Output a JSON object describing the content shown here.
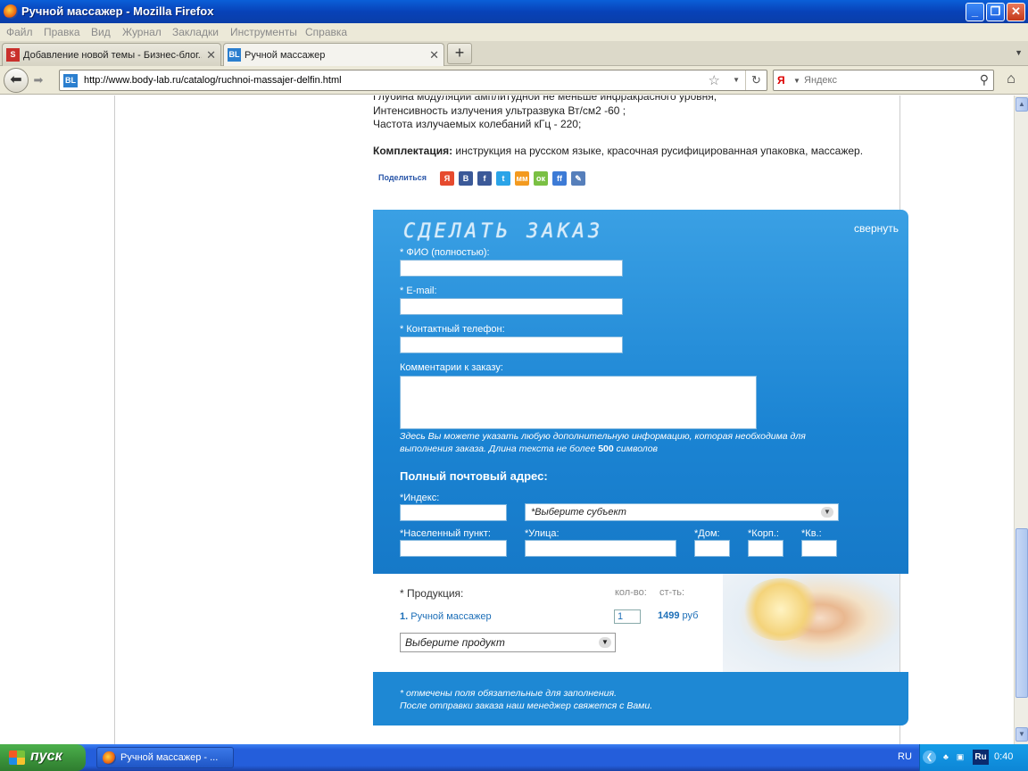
{
  "window": {
    "title": "Ручной массажер - Mozilla Firefox"
  },
  "menu": [
    "Файл",
    "Правка",
    "Вид",
    "Журнал",
    "Закладки",
    "Инструменты",
    "Справка"
  ],
  "tabs": [
    {
      "label": "Добавление новой темы - Бизнес-блог...",
      "favicon": "S",
      "active": false
    },
    {
      "label": "Ручной массажер",
      "favicon": "BL",
      "active": true
    }
  ],
  "nav": {
    "url": "http://www.body-lab.ru/catalog/ruchnoi-massajer-delfin.html",
    "favicon": "BL",
    "search_engine": "Я",
    "search_placeholder": "Яндекс"
  },
  "page": {
    "spec_lines": [
      "Глубина модуляции амплитудной не меньше инфракрасного уровня;",
      "Интенсивность излучения ультразвука Вт/см2 -60 ;",
      "Частота излучаемых колебаний кГц - 220;"
    ],
    "kit_label": "Комплектация:",
    "kit_text": " инструкция на русском языке, красочная русифицированная упаковка, массажер.",
    "share_label": "Поделиться",
    "social": [
      {
        "name": "ya-icon",
        "glyph": "Я",
        "color": "#e64a2e"
      },
      {
        "name": "vk-icon",
        "glyph": "В",
        "color": "#3b5998"
      },
      {
        "name": "facebook-icon",
        "glyph": "f",
        "color": "#3b5998"
      },
      {
        "name": "twitter-icon",
        "glyph": "t",
        "color": "#2aa4e8"
      },
      {
        "name": "moimir-icon",
        "glyph": "мм",
        "color": "#f39a1f"
      },
      {
        "name": "odnoklassniki-icon",
        "glyph": "ок",
        "color": "#7ac043"
      },
      {
        "name": "friendfeed-icon",
        "glyph": "ff",
        "color": "#3d7bd6"
      },
      {
        "name": "livejournal-icon",
        "glyph": "✎",
        "color": "#567fbb"
      }
    ]
  },
  "order": {
    "title": "СДЕЛАТЬ ЗАКАЗ",
    "collapse": "свернуть",
    "fio_label": "* ФИО (полностью):",
    "email_label": "* E-mail:",
    "phone_label": "* Контактный телефон:",
    "comment_label": "Комментарии к заказу:",
    "hint_text": "Здесь Вы можете указать любую дополнительную информацию, которая необходима для выполнения заказа. Длина текста не более ",
    "hint_limit": "500",
    "hint_suffix": " символов",
    "address_title": "Полный почтовый адрес:",
    "index_label": "*Индекс:",
    "region_select": "*Выберите субъект",
    "city_label": "*Населенный пункт:",
    "street_label": "*Улица:",
    "house_label": "*Дом:",
    "building_label": "*Корп.:",
    "apt_label": "*Кв.:"
  },
  "products": {
    "label": "* Продукция:",
    "qty_header": "кол-во:",
    "cost_header": "ст-ть:",
    "item_number": "1.",
    "item_name": "Ручной массажер",
    "item_qty": "1",
    "item_price": "1499",
    "currency": "руб",
    "select_placeholder": "Выберите продукт"
  },
  "footer": {
    "note1": "* отмечены поля обязательные для заполнения.",
    "note2": "После отправки заказа наш менеджер свяжется с Вами."
  },
  "taskbar": {
    "start": "пуск",
    "window_item": "Ручной массажер - ...",
    "lang": "RU",
    "kbd": "Ru",
    "clock": "0:40"
  }
}
